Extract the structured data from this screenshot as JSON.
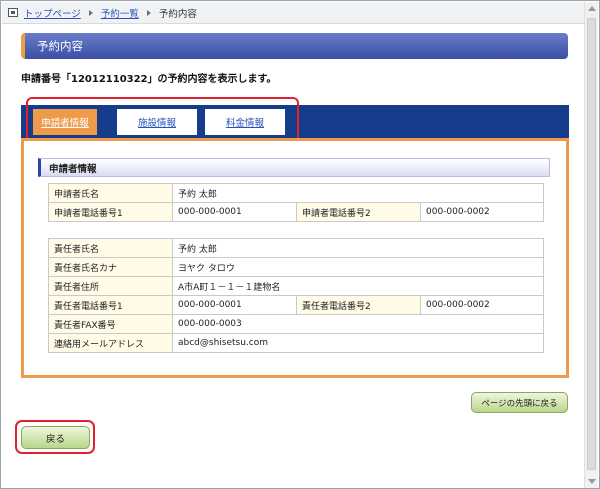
{
  "breadcrumb": {
    "home": "トップページ",
    "list": "予約一覧",
    "current": "予約内容"
  },
  "page_title": "予約内容",
  "intro": "申請番号「12012110322」の予約内容を表示します。",
  "tabs": [
    {
      "label": "申請者情報",
      "active": true
    },
    {
      "label": "施設情報",
      "active": false
    },
    {
      "label": "料金情報",
      "active": false
    }
  ],
  "section_title": "申請者情報",
  "applicant": {
    "name_label": "申請者氏名",
    "name_value": "予約 太郎",
    "phone1_label": "申請者電話番号1",
    "phone1_value": "000-000-0001",
    "phone2_label": "申請者電話番号2",
    "phone2_value": "000-000-0002"
  },
  "responsible": {
    "name_label": "責任者氏名",
    "name_value": "予約 太郎",
    "kana_label": "責任者氏名カナ",
    "kana_value": "ヨヤク タロウ",
    "address_label": "責任者住所",
    "address_value": "A市A町１－１－１建物名",
    "phone1_label": "責任者電話番号1",
    "phone1_value": "000-000-0001",
    "phone2_label": "責任者電話番号2",
    "phone2_value": "000-000-0002",
    "fax_label": "責任者FAX番号",
    "fax_value": "000-000-0003",
    "email_label": "連絡用メールアドレス",
    "email_value": "abcd@shisetsu.com"
  },
  "buttons": {
    "page_top": "ページの先頭に戻る",
    "back": "戻る"
  },
  "colors": {
    "title_bar": "#3a4fa6",
    "tab_band": "#163d8c",
    "active_tab": "#f09a4b",
    "highlight": "#e1212b"
  }
}
